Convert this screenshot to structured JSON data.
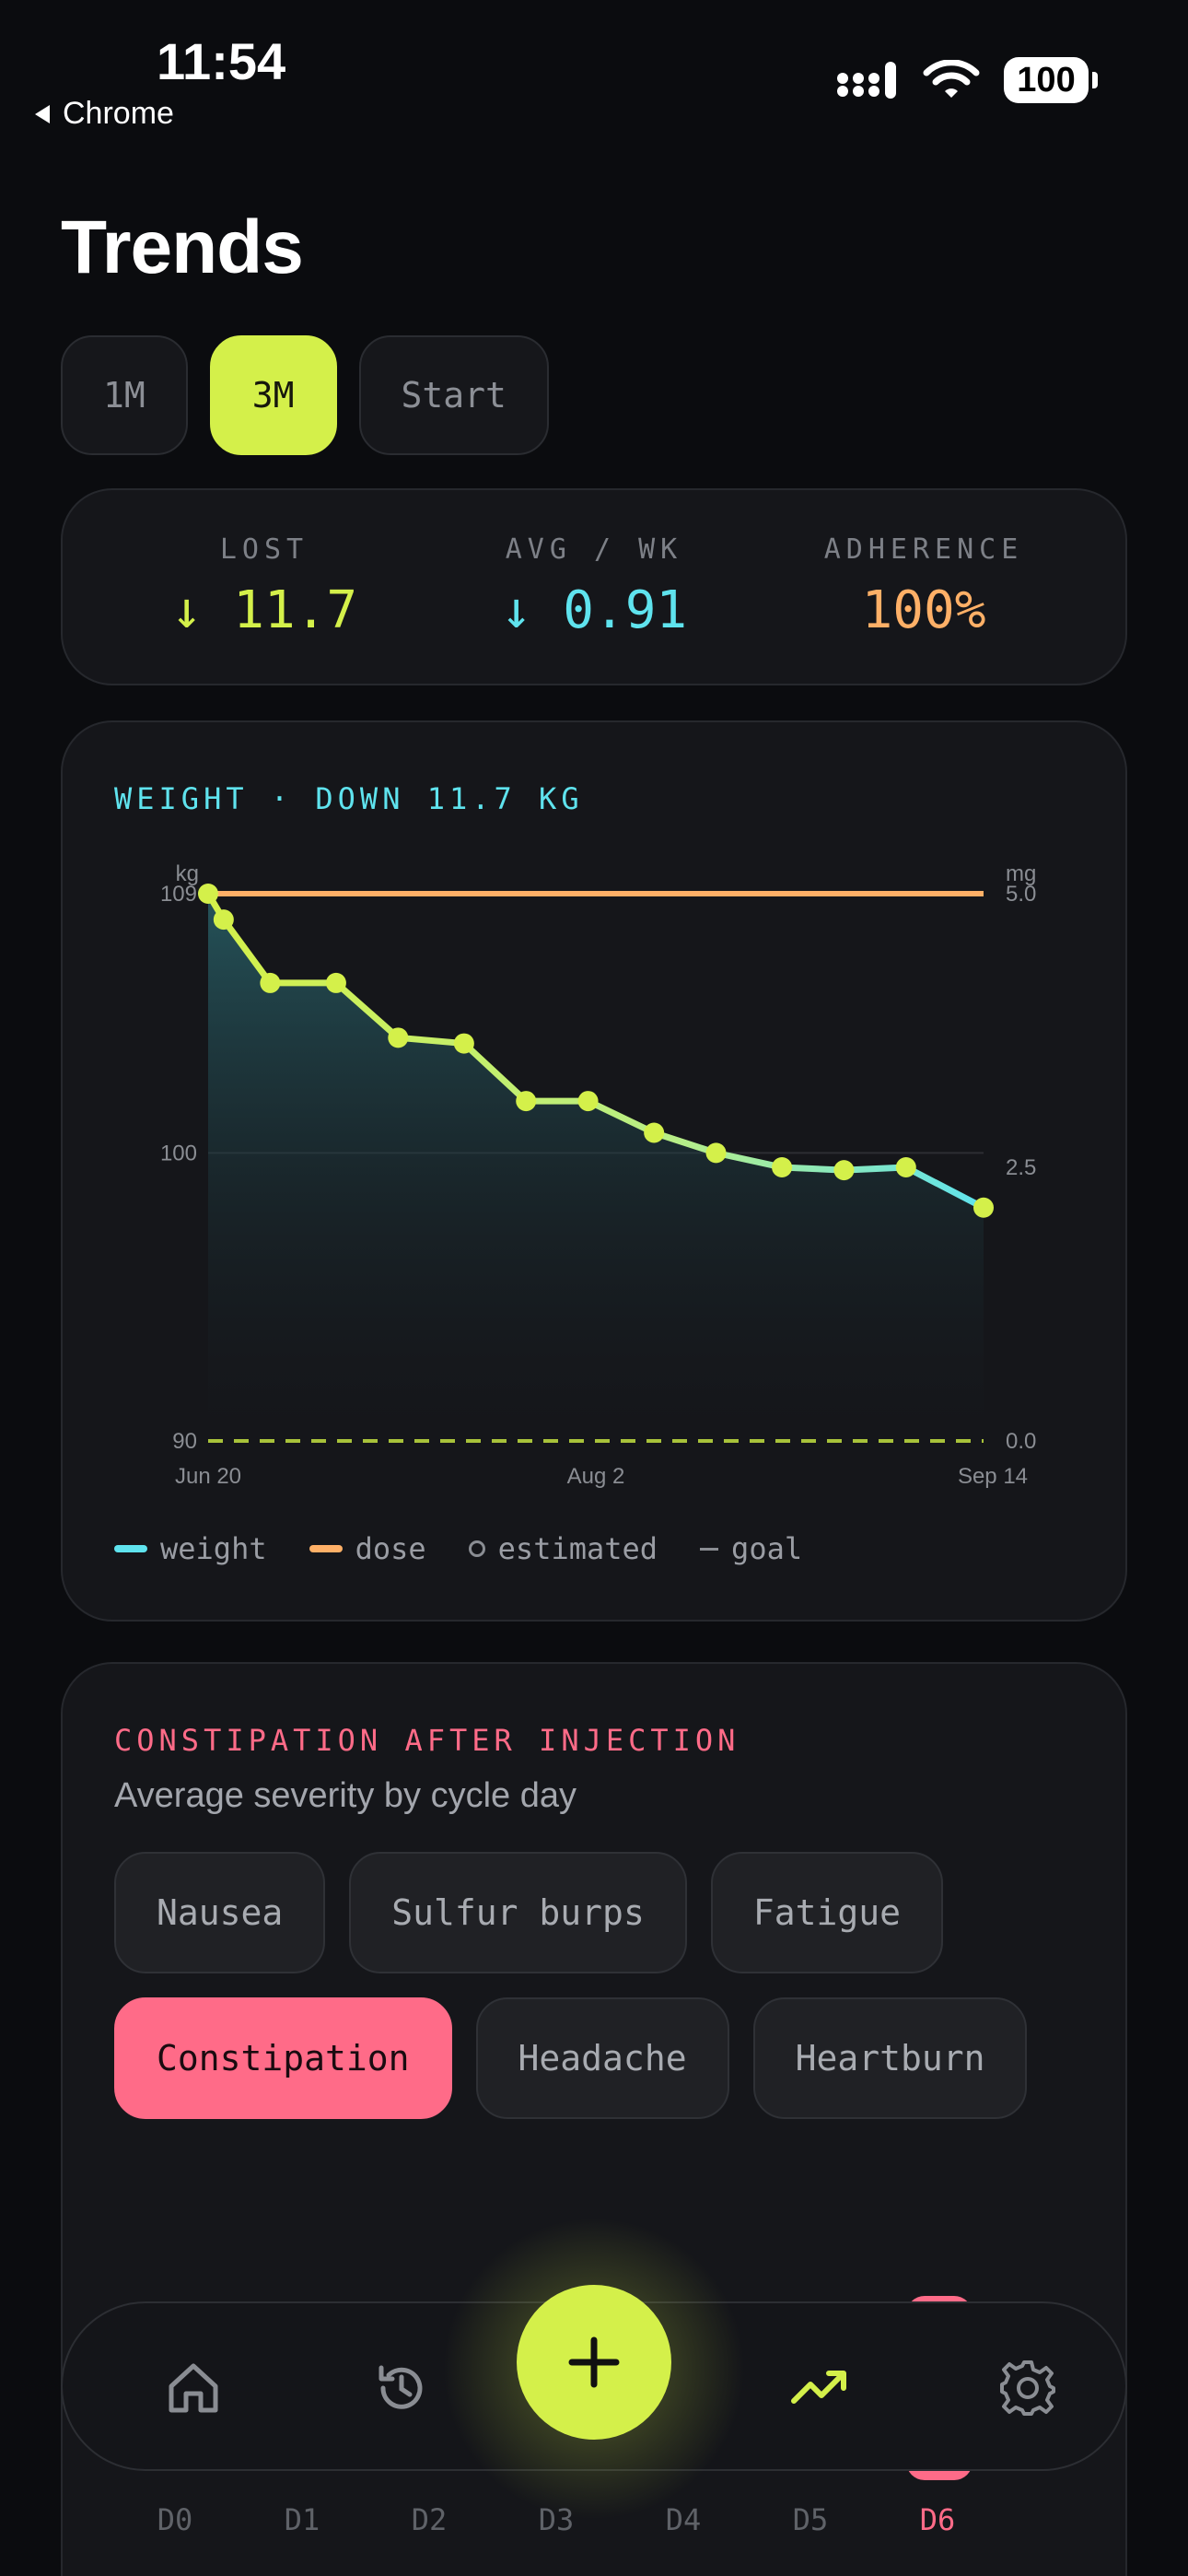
{
  "status_bar": {
    "time": "11:54",
    "back_label": "Chrome",
    "battery": "100"
  },
  "page": {
    "title": "Trends"
  },
  "range_tabs": [
    {
      "label": "1M",
      "active": false
    },
    {
      "label": "3M",
      "active": true
    },
    {
      "label": "Start",
      "active": false
    }
  ],
  "stats": [
    {
      "label": "LOST",
      "value": "↓ 11.7",
      "color": "#d4f04a"
    },
    {
      "label": "AVG / WK",
      "value": "↓ 0.91",
      "color": "#5fe3ee"
    },
    {
      "label": "ADHERENCE",
      "value": "100%",
      "color": "#ffb067"
    }
  ],
  "weight_card": {
    "heading": "WEIGHT · DOWN 11.7 KG",
    "legend": {
      "weight": "weight",
      "dose": "dose",
      "estimated": "estimated",
      "goal": "goal"
    }
  },
  "chart_data": {
    "type": "line",
    "x_tick_labels": [
      "Jun 20",
      "Aug 2",
      "Sep 14"
    ],
    "y_left": {
      "unit": "kg",
      "ticks": [
        "109",
        "100",
        "90"
      ],
      "ylim": [
        90,
        109
      ]
    },
    "y_right": {
      "unit": "mg",
      "ticks": [
        "5.0",
        "2.5",
        "0.0"
      ],
      "ylim": [
        0,
        5
      ]
    },
    "series": [
      {
        "name": "weight",
        "color": "#d4f04a",
        "x": [
          0,
          0.02,
          0.08,
          0.165,
          0.245,
          0.33,
          0.41,
          0.49,
          0.575,
          0.655,
          0.74,
          0.82,
          0.9,
          1.0
        ],
        "values": [
          109,
          108.1,
          105.9,
          105.9,
          104,
          103.8,
          101.8,
          101.8,
          100.7,
          100,
          99.5,
          99.4,
          99.5,
          98.1
        ]
      },
      {
        "name": "dose",
        "color": "#ffb067",
        "x": [
          0,
          1.0
        ],
        "values": [
          5.0,
          5.0
        ]
      }
    ],
    "goal": 90,
    "grid": true,
    "legend_position": "bottom"
  },
  "symptom_card": {
    "heading": "CONSTIPATION AFTER INJECTION",
    "subtitle": "Average severity by cycle day",
    "chips": [
      {
        "label": "Nausea",
        "active": false
      },
      {
        "label": "Sulfur burps",
        "active": false
      },
      {
        "label": "Fatigue",
        "active": false
      },
      {
        "label": "Constipation",
        "active": true
      },
      {
        "label": "Headache",
        "active": false
      },
      {
        "label": "Heartburn",
        "active": false
      }
    ],
    "cycle_days": [
      "D0",
      "D1",
      "D2",
      "D3",
      "D4",
      "D5",
      "D6"
    ],
    "active_day": "D6"
  },
  "nav": {
    "items": [
      {
        "icon": "home-icon"
      },
      {
        "icon": "history-icon"
      },
      {
        "icon": "plus-icon"
      },
      {
        "icon": "trend-icon",
        "active": true
      },
      {
        "icon": "gear-icon"
      }
    ]
  },
  "colors": {
    "accent_lime": "#d4f04a",
    "accent_cyan": "#5fe3ee",
    "accent_orange": "#ffb067",
    "accent_pink": "#ff6b88"
  }
}
